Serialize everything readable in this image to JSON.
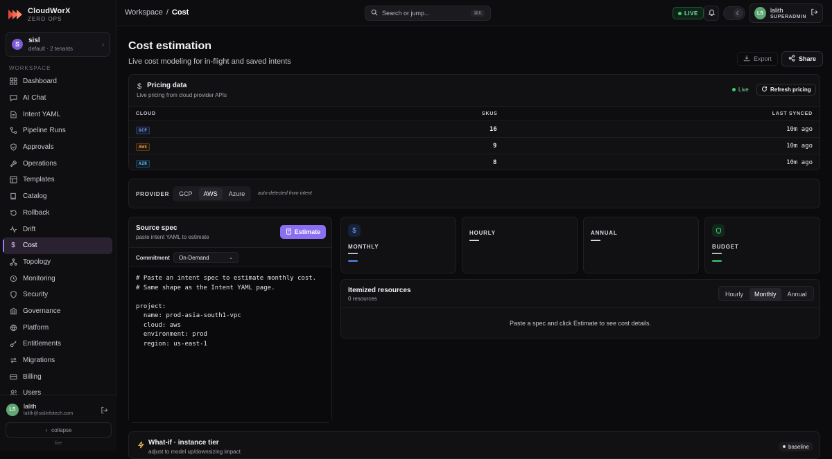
{
  "brand": {
    "name": "CloudWorX",
    "tagline": "ZERO OPS"
  },
  "tenant": {
    "avatar": "S",
    "name": "sisl",
    "sub": "default · 2 tenants"
  },
  "sidebar": {
    "section": "WORKSPACE",
    "items": [
      {
        "label": "Dashboard",
        "icon": "grid-icon"
      },
      {
        "label": "AI Chat",
        "icon": "chat-icon"
      },
      {
        "label": "Intent YAML",
        "icon": "file-icon"
      },
      {
        "label": "Pipeline Runs",
        "icon": "pipeline-icon"
      },
      {
        "label": "Approvals",
        "icon": "shield-check-icon"
      },
      {
        "label": "Operations",
        "icon": "wrench-icon"
      },
      {
        "label": "Templates",
        "icon": "layout-icon"
      },
      {
        "label": "Catalog",
        "icon": "book-icon"
      },
      {
        "label": "Rollback",
        "icon": "rotate-icon"
      },
      {
        "label": "Drift",
        "icon": "activity-icon"
      },
      {
        "label": "Cost",
        "icon": "dollar-icon",
        "active": true
      },
      {
        "label": "Topology",
        "icon": "network-icon"
      },
      {
        "label": "Monitoring",
        "icon": "pulse-icon"
      },
      {
        "label": "Security",
        "icon": "shield-icon"
      },
      {
        "label": "Governance",
        "icon": "building-icon"
      },
      {
        "label": "Platform",
        "icon": "globe-icon"
      },
      {
        "label": "Entitlements",
        "icon": "key-icon"
      },
      {
        "label": "Migrations",
        "icon": "arrows-icon"
      },
      {
        "label": "Billing",
        "icon": "card-icon"
      },
      {
        "label": "Users",
        "icon": "users-icon"
      }
    ],
    "footer": {
      "avatar": "LS",
      "name": "lalith",
      "email": "lalith@sislinfotech.com",
      "collapse": "collapse",
      "status": "live"
    }
  },
  "topbar": {
    "crumb_root": "Workspace",
    "crumb_sep": "/",
    "crumb_current": "Cost",
    "search_placeholder": "Search or jump...",
    "search_shortcut": "⌘K",
    "live": "LIVE",
    "user": {
      "avatar": "LS",
      "name": "lalith",
      "role": "SUPERADMIN"
    }
  },
  "page": {
    "title": "Cost estimation",
    "subtitle": "Live cost modeling for in-flight and saved intents",
    "export": "Export",
    "share": "Share"
  },
  "pricing": {
    "title": "Pricing data",
    "sub": "Live pricing from cloud provider APIs",
    "live": "Live",
    "refresh": "Refresh pricing",
    "columns": [
      "CLOUD",
      "SKUS",
      "LAST SYNCED"
    ],
    "rows": [
      {
        "cloud": "GCP",
        "skus": "16",
        "synced": "10m ago",
        "color": "#5b8def"
      },
      {
        "cloud": "AWS",
        "skus": "9",
        "synced": "10m ago",
        "color": "#e08a3c"
      },
      {
        "cloud": "AZR",
        "skus": "8",
        "synced": "10m ago",
        "color": "#4aa3e0"
      }
    ]
  },
  "provider": {
    "label": "PROVIDER",
    "options": [
      "GCP",
      "AWS",
      "Azure"
    ],
    "selected": "AWS",
    "note": "auto-detected from intent"
  },
  "spec": {
    "title": "Source spec",
    "sub": "paste intent YAML to estimate",
    "estimate": "Estimate",
    "commitment_label": "Commitment",
    "commitment_value": "On-Demand",
    "code": "# Paste an intent spec to estimate monthly cost.\n# Same shape as the Intent YAML page.\n\nproject:\n  name: prod-asia-south1-vpc\n  cloud: aws\n  environment: prod\n  region: us-east-1"
  },
  "stats": [
    {
      "label": "MONTHLY",
      "value": "—",
      "icon": "dollar-icon",
      "accent": "#5b8def"
    },
    {
      "label": "HOURLY",
      "value": "—"
    },
    {
      "label": "ANNUAL",
      "value": "—"
    },
    {
      "label": "BUDGET",
      "value": "—",
      "icon": "shield-icon",
      "accent": "#3ecf72"
    }
  ],
  "itemized": {
    "title": "Itemized resources",
    "count": "0 resources",
    "periods": [
      "Hourly",
      "Monthly",
      "Annual"
    ],
    "selected": "Monthly",
    "empty": "Paste a spec and click Estimate to see cost details."
  },
  "whatif": {
    "title": "What-if · instance tier",
    "sub": "adjust to model up/downsizing impact",
    "badge": "baseline"
  }
}
